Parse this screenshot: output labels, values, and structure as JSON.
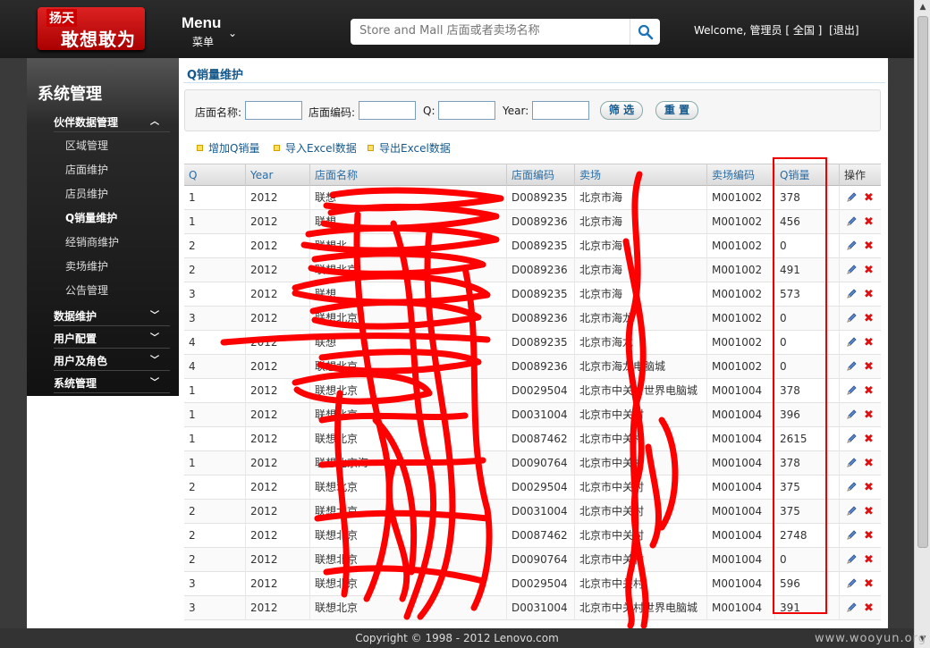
{
  "colors": {
    "accent": "#15588c",
    "brand": "#cc0000",
    "highlight": "#ee0000",
    "header": "#222222"
  },
  "header": {
    "brand": "扬天",
    "slogan": "敢想敢为",
    "menu_title": "Menu",
    "menu_sub": "菜单",
    "search_placeholder": "Store and Mall 店面或者卖场名称",
    "welcome": "Welcome, 管理员 [ 全国 ]",
    "logout": "[退出]"
  },
  "sidebar": {
    "title": "系统管理",
    "groups": [
      {
        "label": "伙伴数据管理",
        "expanded": true
      },
      {
        "label": "数据维护"
      },
      {
        "label": "用户配置"
      },
      {
        "label": "用户及角色"
      },
      {
        "label": "系统管理"
      }
    ],
    "items": [
      {
        "label": "区域管理"
      },
      {
        "label": "店面维护"
      },
      {
        "label": "店员维护"
      },
      {
        "label": "Q销量维护",
        "active": true
      },
      {
        "label": "经销商维护"
      },
      {
        "label": "卖场维护"
      },
      {
        "label": "公告管理"
      }
    ]
  },
  "main": {
    "title": "Q销量维护",
    "filter": {
      "store_name": "店面名称:",
      "store_code": "店面编码:",
      "q": "Q:",
      "year": "Year:",
      "filter_btn": "筛 选",
      "reset_btn": "重 置"
    },
    "actions": [
      "增加Q销量",
      "导入Excel数据",
      "导出Excel数据"
    ],
    "columns": [
      "Q",
      "Year",
      "店面名称",
      "店面编码",
      "卖场",
      "卖场编码",
      "Q销量",
      "操作"
    ],
    "rows": [
      [
        "1",
        "2012",
        "联想",
        "D0089235",
        "北京市海",
        "M001002",
        "378"
      ],
      [
        "1",
        "2012",
        "联想",
        "D0089236",
        "北京市海",
        "M001002",
        "456"
      ],
      [
        "2",
        "2012",
        "联想北",
        "D0089235",
        "北京市海",
        "M001002",
        "0"
      ],
      [
        "2",
        "2012",
        "联想北京",
        "D0089236",
        "北京市海",
        "M001002",
        "491"
      ],
      [
        "3",
        "2012",
        "联想",
        "D0089235",
        "北京市海",
        "M001002",
        "573"
      ],
      [
        "3",
        "2012",
        "联想北京",
        "D0089236",
        "北京市海龙",
        "M001002",
        "0"
      ],
      [
        "4",
        "2012",
        "联想",
        "D0089235",
        "北京市海龙",
        "M001002",
        "0"
      ],
      [
        "4",
        "2012",
        "联想北京",
        "D0089236",
        "北京市海龙电脑城",
        "M001002",
        "0"
      ],
      [
        "1",
        "2012",
        "联想北京",
        "D0029504",
        "北京市中关村世界电脑城",
        "M001004",
        "378"
      ],
      [
        "1",
        "2012",
        "联想北京",
        "D0031004",
        "北京市中关村",
        "M001004",
        "396"
      ],
      [
        "1",
        "2012",
        "联想北京",
        "D0087462",
        "北京市中关村",
        "M001004",
        "2615"
      ],
      [
        "1",
        "2012",
        "联想北京海",
        "D0090764",
        "北京市中关村",
        "M001004",
        "378"
      ],
      [
        "2",
        "2012",
        "联想北京",
        "D0029504",
        "北京市中关村",
        "M001004",
        "375"
      ],
      [
        "2",
        "2012",
        "联想北京",
        "D0031004",
        "北京市中关村",
        "M001004",
        "375"
      ],
      [
        "2",
        "2012",
        "联想北京",
        "D0087462",
        "北京市中关村",
        "M001004",
        "2748"
      ],
      [
        "2",
        "2012",
        "联想北京",
        "D0090764",
        "北京市中关村",
        "M001004",
        "0"
      ],
      [
        "3",
        "2012",
        "联想北京",
        "D0029504",
        "北京市中关村",
        "M001004",
        "596"
      ],
      [
        "3",
        "2012",
        "联想北京",
        "D0031004",
        "北京市中关村世界电脑城",
        "M001004",
        "391"
      ]
    ]
  },
  "footer": {
    "copyright": "Copyright © 1998 - 2012 Lenovo.com"
  },
  "watermark": "www.wooyun.org"
}
